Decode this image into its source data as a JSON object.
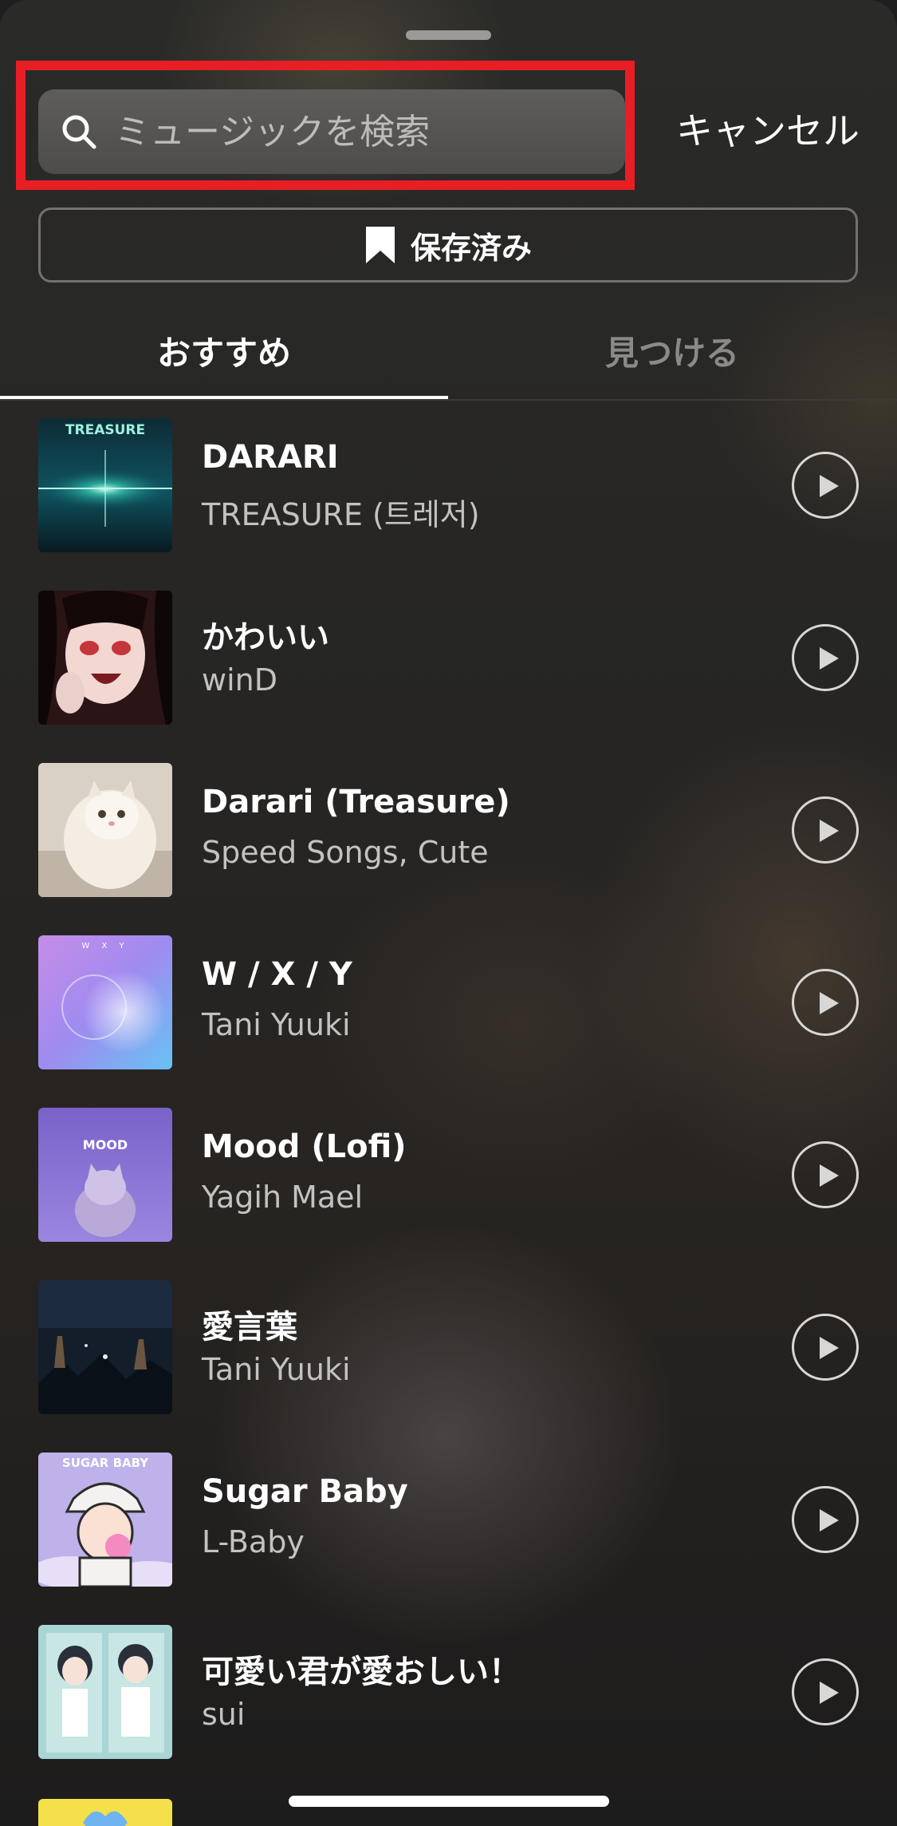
{
  "search": {
    "placeholder": "ミュージックを検索",
    "cancel_label": "キャンセル"
  },
  "saved": {
    "label": "保存済み"
  },
  "tabs": [
    {
      "label": "おすすめ",
      "active": true
    },
    {
      "label": "見つける",
      "active": false
    }
  ],
  "tracks": [
    {
      "title": "DARARI",
      "artist": "TREASURE (트레저)",
      "cover_text": "TREASURE"
    },
    {
      "title": "かわいい",
      "artist": "winD"
    },
    {
      "title": "Darari (Treasure)",
      "artist": "Speed Songs, Cute"
    },
    {
      "title": "W / X / Y",
      "artist": "Tani Yuuki",
      "cover_text": "W X Y"
    },
    {
      "title": "Mood (Lofi)",
      "artist": "Yagih Mael",
      "cover_text": "MOOD"
    },
    {
      "title": "愛言葉",
      "artist": "Tani Yuuki"
    },
    {
      "title": "Sugar Baby",
      "artist": "L-Baby",
      "cover_text": "SUGAR BABY"
    },
    {
      "title": "可愛い君が愛おしい！",
      "artist": "sui"
    }
  ],
  "colors": {
    "highlight": "#e81e25",
    "background": "#262524",
    "text_primary": "#ffffff",
    "text_secondary": "#c3c2c0"
  }
}
